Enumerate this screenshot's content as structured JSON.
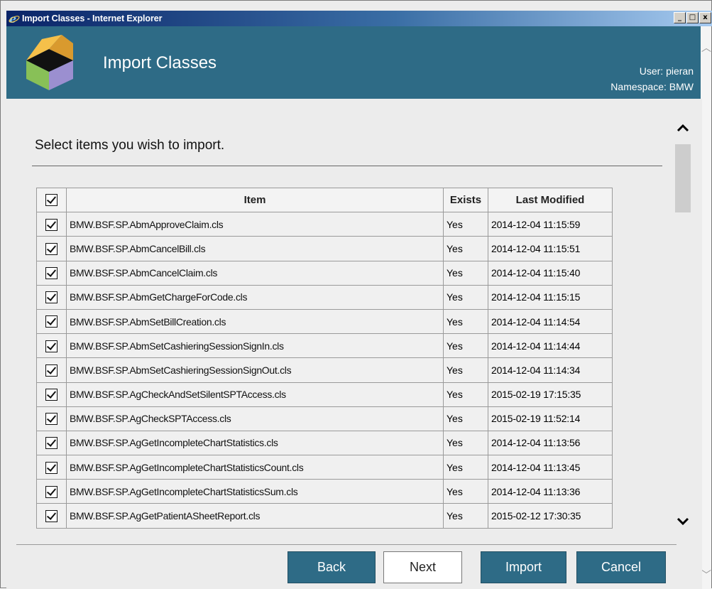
{
  "window": {
    "title": "Import Classes - Internet Explorer",
    "controls": [
      "_",
      "□",
      "x"
    ]
  },
  "header": {
    "app_title": "Import Classes",
    "user_line": "User: pieran",
    "namespace_line": "Namespace: BMW"
  },
  "instruction": "Select items you wish to import.",
  "table": {
    "columns": [
      "Item",
      "Exists",
      "Last Modified"
    ],
    "rows": [
      {
        "item": "BMW.BSF.SP.AbmApproveClaim.cls",
        "exists": "Yes",
        "modified": "2014-12-04 11:15:59",
        "checked": true
      },
      {
        "item": "BMW.BSF.SP.AbmCancelBill.cls",
        "exists": "Yes",
        "modified": "2014-12-04 11:15:51",
        "checked": true
      },
      {
        "item": "BMW.BSF.SP.AbmCancelClaim.cls",
        "exists": "Yes",
        "modified": "2014-12-04 11:15:40",
        "checked": true
      },
      {
        "item": "BMW.BSF.SP.AbmGetChargeForCode.cls",
        "exists": "Yes",
        "modified": "2014-12-04 11:15:15",
        "checked": true
      },
      {
        "item": "BMW.BSF.SP.AbmSetBillCreation.cls",
        "exists": "Yes",
        "modified": "2014-12-04 11:14:54",
        "checked": true
      },
      {
        "item": "BMW.BSF.SP.AbmSetCashieringSessionSignIn.cls",
        "exists": "Yes",
        "modified": "2014-12-04 11:14:44",
        "checked": true
      },
      {
        "item": "BMW.BSF.SP.AbmSetCashieringSessionSignOut.cls",
        "exists": "Yes",
        "modified": "2014-12-04 11:14:34",
        "checked": true
      },
      {
        "item": "BMW.BSF.SP.AgCheckAndSetSilentSPTAccess.cls",
        "exists": "Yes",
        "modified": "2015-02-19 17:15:35",
        "checked": true
      },
      {
        "item": "BMW.BSF.SP.AgCheckSPTAccess.cls",
        "exists": "Yes",
        "modified": "2015-02-19 11:52:14",
        "checked": true
      },
      {
        "item": "BMW.BSF.SP.AgGetIncompleteChartStatistics.cls",
        "exists": "Yes",
        "modified": "2014-12-04 11:13:56",
        "checked": true
      },
      {
        "item": "BMW.BSF.SP.AgGetIncompleteChartStatisticsCount.cls",
        "exists": "Yes",
        "modified": "2014-12-04 11:13:45",
        "checked": true
      },
      {
        "item": "BMW.BSF.SP.AgGetIncompleteChartStatisticsSum.cls",
        "exists": "Yes",
        "modified": "2014-12-04 11:13:36",
        "checked": true
      },
      {
        "item": "BMW.BSF.SP.AgGetPatientASheetReport.cls",
        "exists": "Yes",
        "modified": "2015-02-12 17:30:35",
        "checked": true
      }
    ]
  },
  "buttons": {
    "back": "Back",
    "next": "Next",
    "import": "Import",
    "cancel": "Cancel"
  },
  "colors": {
    "header_bg": "#2e6b86",
    "button_bg": "#2e6b86",
    "page_bg": "#ececec"
  },
  "icons": {
    "ie": "internet-explorer-icon",
    "logo": "isometric-box-logo",
    "scroll_up": "chevron-up-icon",
    "scroll_down": "chevron-down-icon"
  }
}
